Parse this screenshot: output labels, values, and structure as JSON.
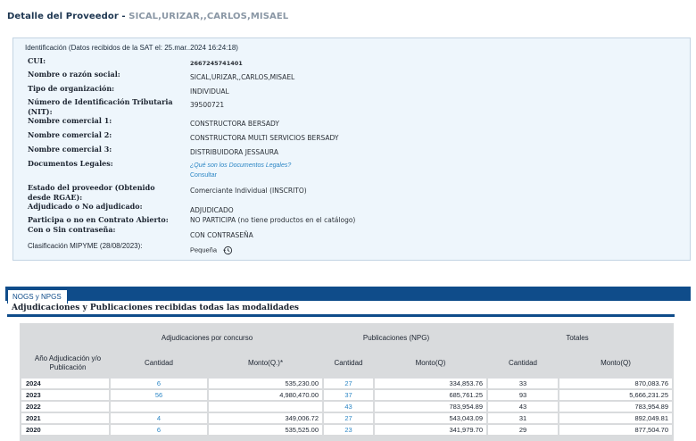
{
  "page": {
    "title": "Detalle del Proveedor - ",
    "provider_name": "SICAL,URIZAR,,CARLOS,MISAEL"
  },
  "identification": {
    "header": "Identificación (Datos recibidos de la SAT el: 25.mar..2024 16:24:18)",
    "fields": [
      {
        "label": "CUI:",
        "value": "2667245741401"
      },
      {
        "label": "Nombre o razón social:",
        "value": "SICAL,URIZAR,,CARLOS,MISAEL"
      },
      {
        "label": "Tipo de organización:",
        "value": "INDIVIDUAL"
      },
      {
        "label": "Número de Identificación Tributaria (NIT):",
        "value": "39500721"
      },
      {
        "label": "Nombre comercial 1:",
        "value": "CONSTRUCTORA BERSADY"
      },
      {
        "label": "Nombre comercial 2:",
        "value": "CONSTRUCTORA MULTI SERVICIOS BERSADY"
      },
      {
        "label": "Nombre comercial 3:",
        "value": "DISTRIBUIDORA JESSAURA"
      },
      {
        "label": "Documentos Legales:",
        "link_question": "¿Qué son los Documentos Legales?",
        "link_consult": "Consultar"
      },
      {
        "label": "Estado del proveedor (Obtenido desde RGAE):",
        "value": "Comerciante Individual (INSCRITO)"
      },
      {
        "label": "Adjudicado o No adjudicado:",
        "value": "ADJUDICADO"
      },
      {
        "label": "Participa o no en Contrato Abierto:",
        "value": "NO PARTICIPA (no tiene productos en el catálogo)"
      },
      {
        "label": "Con o Sin contraseña:",
        "value": "CON CONTRASEÑA"
      },
      {
        "label": "Clasificación MIPYME (28/08/2023):",
        "value": "Pequeña"
      }
    ]
  },
  "tabs": [
    {
      "label": "NOGS y NPGS"
    }
  ],
  "section": {
    "title": "Adjudicaciones y Publicaciones recibidas todas las modalidades"
  },
  "table": {
    "group_headers": [
      "Adjudicaciones por concurso",
      "Publicaciones (NPG)",
      "Totales"
    ],
    "columns": [
      "Año Adjudicación y/o Publicación",
      "Cantidad",
      "Monto(Q.)*",
      "Cantidad",
      "Monto(Q)",
      "Cantidad",
      "Monto(Q)"
    ],
    "rows": [
      [
        "2024",
        "6",
        "535,230.00",
        "27",
        "334,853.76",
        "33",
        "870,083.76"
      ],
      [
        "2023",
        "56",
        "4,980,470.00",
        "37",
        "685,761.25",
        "93",
        "5,666,231.25"
      ],
      [
        "2022",
        "",
        "",
        "43",
        "783,954.89",
        "43",
        "783,954.89"
      ],
      [
        "2021",
        "4",
        "349,006.72",
        "27",
        "543,043.09",
        "31",
        "892,049.81"
      ],
      [
        "2020",
        "6",
        "535,525.00",
        "23",
        "341,979.70",
        "29",
        "877,504.70"
      ]
    ]
  },
  "colors": {
    "accent": "#0f4c8a",
    "link": "#2b86c5",
    "panel_bg": "#eef6fc"
  },
  "icons": {
    "mipyme_history": "history-icon"
  }
}
